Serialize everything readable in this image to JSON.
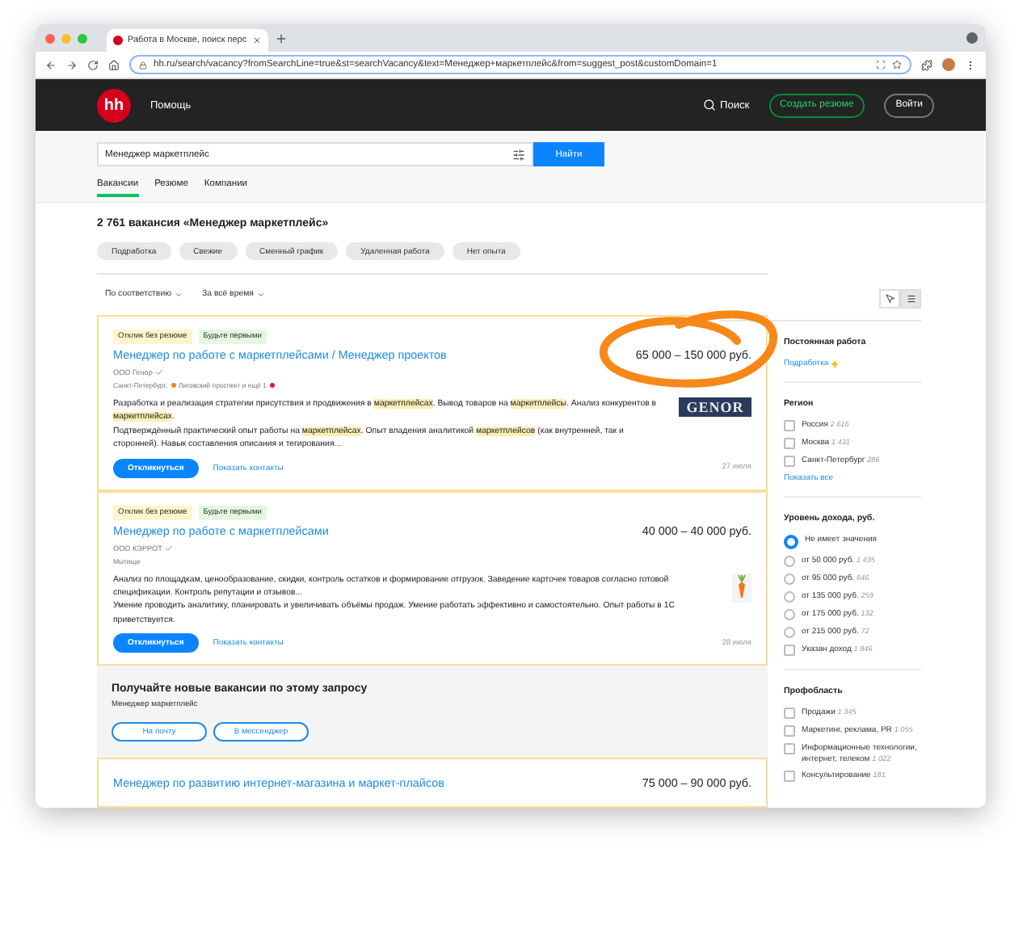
{
  "browser": {
    "tab_title": "Работа в Москве, поиск перс",
    "url": "hh.ru/search/vacancy?fromSearchLine=true&st=searchVacancy&text=Менеджер+маркетплейс&from=suggest_post&customDomain=1"
  },
  "header": {
    "logo": "hh",
    "help": "Помощь",
    "search": "Поиск",
    "create_resume": "Создать резюме",
    "login": "Войти"
  },
  "search": {
    "value": "Менеджер маркетплейс",
    "button": "Найти"
  },
  "tabs": [
    {
      "label": "Вакансии",
      "selected": true
    },
    {
      "label": "Резюме",
      "selected": false
    },
    {
      "label": "Компании",
      "selected": false
    }
  ],
  "results_title": "2 761 вакансия «Менеджер маркетплейс»",
  "chips": [
    "Подработка",
    "Свежие",
    "Сменный график",
    "Удаленная работа",
    "Нет опыта"
  ],
  "sort": [
    "По соответствию",
    "За всё время"
  ],
  "view_toggle": [
    {
      "kind": "map",
      "selected": false
    },
    {
      "kind": "list",
      "selected": true
    }
  ],
  "vacancies": [
    {
      "tags": [
        {
          "label": "Отклик без резюме",
          "kind": "no-resume"
        },
        {
          "label": "Будьте первыми",
          "kind": "be-first"
        }
      ],
      "title": "Менеджер по работе с маркетплейсами / Менеджер проектов",
      "salary": "65 000 – 150 000 руб.",
      "company": "ООО Генор",
      "verified": true,
      "location": "Санкт-Петербург,",
      "metro": [
        {
          "color": "#f58220",
          "label": "Лиговский проспект и ещё 1"
        },
        {
          "color": "#e4173e"
        }
      ],
      "description": [
        "Разработка и реализация стратегии присутствия и продвижения в **маркетплейсах**. Вывод товаров на **маркетплейсы**. Анализ конкурентов в **маркетплейсах**.",
        "Подтверждённый практический опыт работы на **маркетплейсах**. Опыт владения аналитикой **маркетплейсов** (как внутренней, так и сторонней). Навык составления описания и тегирования..."
      ],
      "logo": {
        "kind": "genor",
        "text": "GENOR"
      },
      "respond": "Откликнуться",
      "contacts": "Показать контакты",
      "date": "27 июля"
    },
    {
      "tags": [
        {
          "label": "Отклик без резюме",
          "kind": "no-resume"
        },
        {
          "label": "Будьте первыми",
          "kind": "be-first"
        }
      ],
      "title": "Менеджер по работе с маркетплейсами",
      "salary": "40 000 – 40 000 руб.",
      "company": "ООО КЭРРОТ",
      "verified": true,
      "location": "Мытищи",
      "description": [
        "Анализ по площадкам, ценообразование, скидки, контроль остатков и формирование отгрузок. Заведение карточек товаров согласно готовой спецификации. Контроль репутации и отзывов...",
        "Умение проводить аналитику, планировать и увеличивать объёмы продаж. Умение работать эффективно и самостоятельно. Опыт работы в 1С приветствуется."
      ],
      "logo": {
        "kind": "carrot"
      },
      "respond": "Откликнуться",
      "contacts": "Показать контакты",
      "date": "28 июля"
    }
  ],
  "subscribe": {
    "title": "Получайте новые вакансии по этому запросу",
    "query": "Менеджер маркетплейс",
    "buttons": [
      "На почту",
      "В мессенджер"
    ]
  },
  "next_vacancy": {
    "title": "Менеджер по развитию интернет-магазина и маркет-плайсов",
    "salary": "75 000 – 90 000 руб."
  },
  "sidebar": {
    "sections": [
      {
        "title": "Постоянная работа",
        "kind": "links",
        "items": [
          {
            "label": "Подработка"
          }
        ]
      },
      {
        "title": "Регион",
        "kind": "checks",
        "items": [
          {
            "label": "Россия",
            "count": "2 616",
            "checked": false
          },
          {
            "label": "Москва",
            "count": "1 431",
            "checked": false
          },
          {
            "label": "Санкт-Петербург",
            "count": "286",
            "checked": false
          }
        ],
        "more": "Показать все"
      },
      {
        "title": "Уровень дохода, руб.",
        "kind": "radios",
        "items": [
          {
            "label": "Не имеет значения",
            "selected": true
          },
          {
            "label": "от 50 000 руб.",
            "count": "1 435",
            "selected": false
          },
          {
            "label": "от 95 000 руб.",
            "count": "646",
            "selected": false
          },
          {
            "label": "от 135 000 руб.",
            "count": "259",
            "selected": false
          },
          {
            "label": "от 175 000 руб.",
            "count": "132",
            "selected": false
          },
          {
            "label": "от 215 000 руб.",
            "count": "72",
            "selected": false
          }
        ],
        "extra": {
          "label": "Указан доход",
          "count": "1 846",
          "checked": false
        }
      },
      {
        "title": "Профобласть",
        "kind": "checks",
        "items": [
          {
            "label": "Продажи",
            "count": "1 345",
            "checked": false
          },
          {
            "label": "Маркетинг, реклама, PR",
            "count": "1 055",
            "checked": false
          },
          {
            "label": "Информационные технологии, интернет, телеком",
            "count": "1 022",
            "checked": false
          },
          {
            "label": "Консультирование",
            "count": "181",
            "checked": false
          }
        ]
      }
    ]
  }
}
